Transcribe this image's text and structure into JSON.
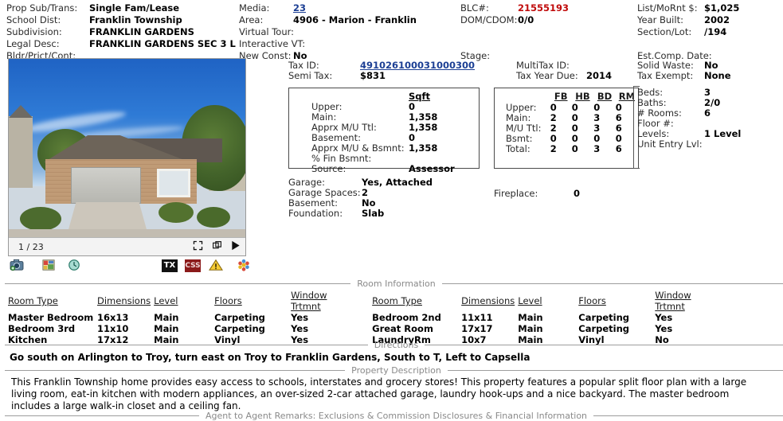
{
  "top": {
    "col_a": [
      {
        "label": "Prop Sub/Trans:",
        "value": "Single Fam/Lease"
      },
      {
        "label": "School Dist:",
        "value": "Franklin Township"
      },
      {
        "label": "Subdivision:",
        "value": "FRANKLIN GARDENS"
      },
      {
        "label": "Legal Desc:",
        "value": "FRANKLIN GARDENS SEC 3 L"
      },
      {
        "label": "Bldr/Prjct/Cont:",
        "value": ""
      }
    ],
    "col_b": [
      {
        "label": "Media:",
        "value": "23",
        "link": true
      },
      {
        "label": "Area:",
        "value": "4906 - Marion - Franklin"
      },
      {
        "label": "Virtual Tour:",
        "value": ""
      },
      {
        "label": "Interactive VT:",
        "value": ""
      },
      {
        "label": "New Const:",
        "value": "No"
      }
    ],
    "col_c": [
      {
        "label": "BLC#:",
        "value": "21555193",
        "red": true
      },
      {
        "label": "DOM/CDOM:",
        "value": "0/0"
      },
      {
        "label": "",
        "value": ""
      },
      {
        "label": "",
        "value": ""
      },
      {
        "label": "Stage:",
        "value": ""
      }
    ],
    "col_d": [
      {
        "label": "List/MoRnt $:",
        "value": "$1,025"
      },
      {
        "label": "Year Built:",
        "value": "2002"
      },
      {
        "label": "Section/Lot:",
        "value": "/194"
      },
      {
        "label": "",
        "value": ""
      },
      {
        "label": "Est.Comp. Date:",
        "value": ""
      }
    ]
  },
  "photo": {
    "counter": "1 / 23",
    "expand_icon": "expand-icon",
    "duplicate_icon": "duplicate-icon",
    "play_icon": "play-icon"
  },
  "icon_bar": {
    "camera": "camera-icon",
    "map": "map-icon",
    "history": "history-clock-icon",
    "tx_badge": "TX",
    "css_badge": "CSS",
    "warning": "warning-icon",
    "cluster": "color-cluster-icon"
  },
  "tax": [
    {
      "label": "Tax ID:",
      "value": "491026100031000300",
      "link": true
    },
    {
      "label": "Semi Tax:",
      "value": "$831"
    }
  ],
  "multitax": [
    {
      "label": "MultiTax ID:",
      "value": ""
    },
    {
      "label": "Tax Year Due:",
      "value": "2014"
    }
  ],
  "waste": [
    {
      "label": "Solid Waste:",
      "value": "No"
    },
    {
      "label": "Tax Exempt:",
      "value": "None"
    }
  ],
  "sqft": {
    "header": "Sqft",
    "rows": [
      {
        "label": "Upper:",
        "value": "0"
      },
      {
        "label": "Main:",
        "value": "1,358"
      },
      {
        "label": "Apprx M/U Ttl:",
        "value": "1,358"
      },
      {
        "label": "Basement:",
        "value": "0"
      },
      {
        "label": "Apprx M/U & Bsmnt:",
        "value": "1,358"
      },
      {
        "label": "% Fin Bsmnt:",
        "value": ""
      },
      {
        "label": "Source:",
        "value": "Assessor"
      }
    ]
  },
  "fbtable": {
    "columns": [
      "FB",
      "HB",
      "BD",
      "RM"
    ],
    "rows": [
      {
        "label": "Upper:",
        "values": [
          "0",
          "0",
          "0",
          "0"
        ]
      },
      {
        "label": "Main:",
        "values": [
          "2",
          "0",
          "3",
          "6"
        ]
      },
      {
        "label": "M/U Ttl:",
        "values": [
          "2",
          "0",
          "3",
          "6"
        ]
      },
      {
        "label": "Bsmt:",
        "values": [
          "0",
          "0",
          "0",
          "0"
        ]
      },
      {
        "label": "Total:",
        "values": [
          "2",
          "0",
          "3",
          "6"
        ]
      }
    ]
  },
  "beds": [
    {
      "label": "Beds:",
      "value": "3"
    },
    {
      "label": "Baths:",
      "value": "2/0"
    },
    {
      "label": "# Rooms:",
      "value": "6"
    },
    {
      "label": "Floor #:",
      "value": ""
    },
    {
      "label": "Levels:",
      "value": "1 Level"
    },
    {
      "label": "Unit Entry Lvl:",
      "value": ""
    }
  ],
  "garage": [
    {
      "label": "Garage:",
      "value": "Yes, Attached"
    },
    {
      "label": "Garage Spaces:",
      "value": "2"
    },
    {
      "label": "Basement:",
      "value": "No"
    },
    {
      "label": "Foundation:",
      "value": "Slab"
    }
  ],
  "fireplace": {
    "label": "Fireplace:",
    "value": "0"
  },
  "sections": {
    "rooms": "Room Information",
    "directions": "Directions",
    "description": "Property Description",
    "remarks": "Agent to Agent Remarks: Exclusions & Commission Disclosures & Financial Information"
  },
  "room_table": {
    "columns": [
      "Room Type",
      "Dimensions",
      "Level",
      "Floors",
      "Window Trtmnt"
    ],
    "left_rows": [
      {
        "type": "Master Bedroom",
        "dim": "16x13",
        "level": "Main",
        "floors": "Carpeting",
        "window": "Yes"
      },
      {
        "type": "Bedroom 3rd",
        "dim": "11x10",
        "level": "Main",
        "floors": "Carpeting",
        "window": "Yes"
      },
      {
        "type": "Kitchen",
        "dim": "17x12",
        "level": "Main",
        "floors": "Vinyl",
        "window": "Yes"
      }
    ],
    "right_rows": [
      {
        "type": "Bedroom 2nd",
        "dim": "11x11",
        "level": "Main",
        "floors": "Carpeting",
        "window": "Yes"
      },
      {
        "type": "Great Room",
        "dim": "17x17",
        "level": "Main",
        "floors": "Carpeting",
        "window": "Yes"
      },
      {
        "type": "LaundryRm",
        "dim": "10x7",
        "level": "Main",
        "floors": "Vinyl",
        "window": "No"
      }
    ]
  },
  "directions_text": "Go south on Arlington to Troy, turn east on Troy to Franklin Gardens, South to T, Left to Capsella",
  "description_text": "This Franklin Township home provides easy access to schools, interstates and grocery stores! This property features a popular split floor plan with a large living room, eat-in kitchen with modern appliances, an over-sized 2-car attached garage, laundry hook-ups and a nice backyard. The master bedroom includes a large walk-in closet and a ceiling fan.",
  "colors": {
    "blc_red": "#c00a0a",
    "link_blue": "#1c3f94",
    "section_gray": "#8a8a8a"
  }
}
